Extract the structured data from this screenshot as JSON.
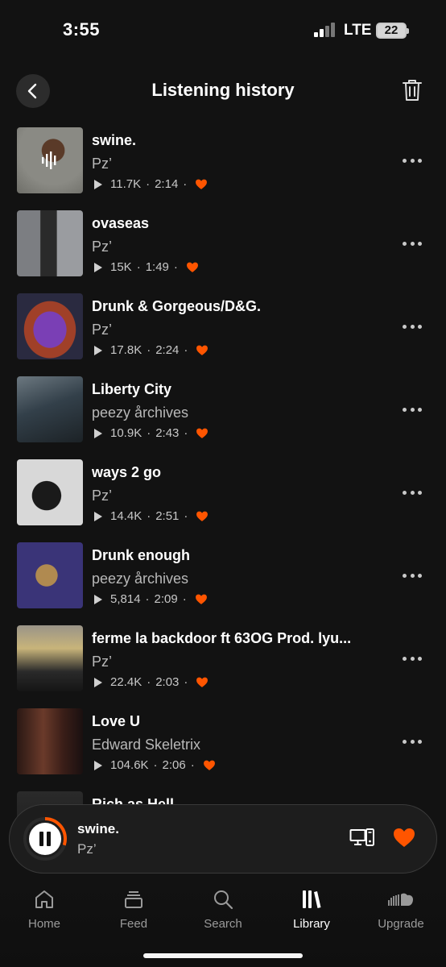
{
  "status": {
    "time": "3:55",
    "network": "LTE",
    "battery": "22"
  },
  "header": {
    "title": "Listening history",
    "back_icon": "chevron-left-icon",
    "trash_icon": "trash-icon"
  },
  "colors": {
    "accent": "#ff5500",
    "background": "#121212",
    "secondary_text": "#b8b8b8"
  },
  "tracks": [
    {
      "title": "swine.",
      "artist": "Pz’",
      "plays": "11.7K",
      "duration": "2:14",
      "liked": true,
      "now_playing": true
    },
    {
      "title": "ovaseas",
      "artist": "Pz’",
      "plays": "15K",
      "duration": "1:49",
      "liked": true,
      "now_playing": false
    },
    {
      "title": "Drunk & Gorgeous/D&G.",
      "artist": "Pz’",
      "plays": "17.8K",
      "duration": "2:24",
      "liked": true,
      "now_playing": false
    },
    {
      "title": "Liberty City",
      "artist": "peezy årchives",
      "plays": "10.9K",
      "duration": "2:43",
      "liked": true,
      "now_playing": false
    },
    {
      "title": "ways 2 go",
      "artist": "Pz’",
      "plays": "14.4K",
      "duration": "2:51",
      "liked": true,
      "now_playing": false
    },
    {
      "title": "Drunk enough",
      "artist": "peezy årchives",
      "plays": "5,814",
      "duration": "2:09",
      "liked": true,
      "now_playing": false
    },
    {
      "title": "ferme la backdoor ft 63OG Prod. lyu...",
      "artist": "Pz’",
      "plays": "22.4K",
      "duration": "2:03",
      "liked": true,
      "now_playing": false
    },
    {
      "title": "Love U",
      "artist": "Edward Skeletrix",
      "plays": "104.6K",
      "duration": "2:06",
      "liked": true,
      "now_playing": false
    },
    {
      "title": "Rich as Hell",
      "artist": "",
      "plays": "",
      "duration": "",
      "liked": false,
      "now_playing": false
    }
  ],
  "mini_player": {
    "title": "swine.",
    "artist": "Pz’",
    "state": "playing",
    "pause_icon": "pause-icon",
    "cast_icon": "cast-devices-icon",
    "like_icon": "heart-icon",
    "progress": 0.3
  },
  "nav": [
    {
      "label": "Home",
      "icon": "home-icon",
      "active": false
    },
    {
      "label": "Feed",
      "icon": "feed-icon",
      "active": false
    },
    {
      "label": "Search",
      "icon": "search-icon",
      "active": false
    },
    {
      "label": "Library",
      "icon": "library-icon",
      "active": true
    },
    {
      "label": "Upgrade",
      "icon": "cloud-icon",
      "active": false
    }
  ]
}
